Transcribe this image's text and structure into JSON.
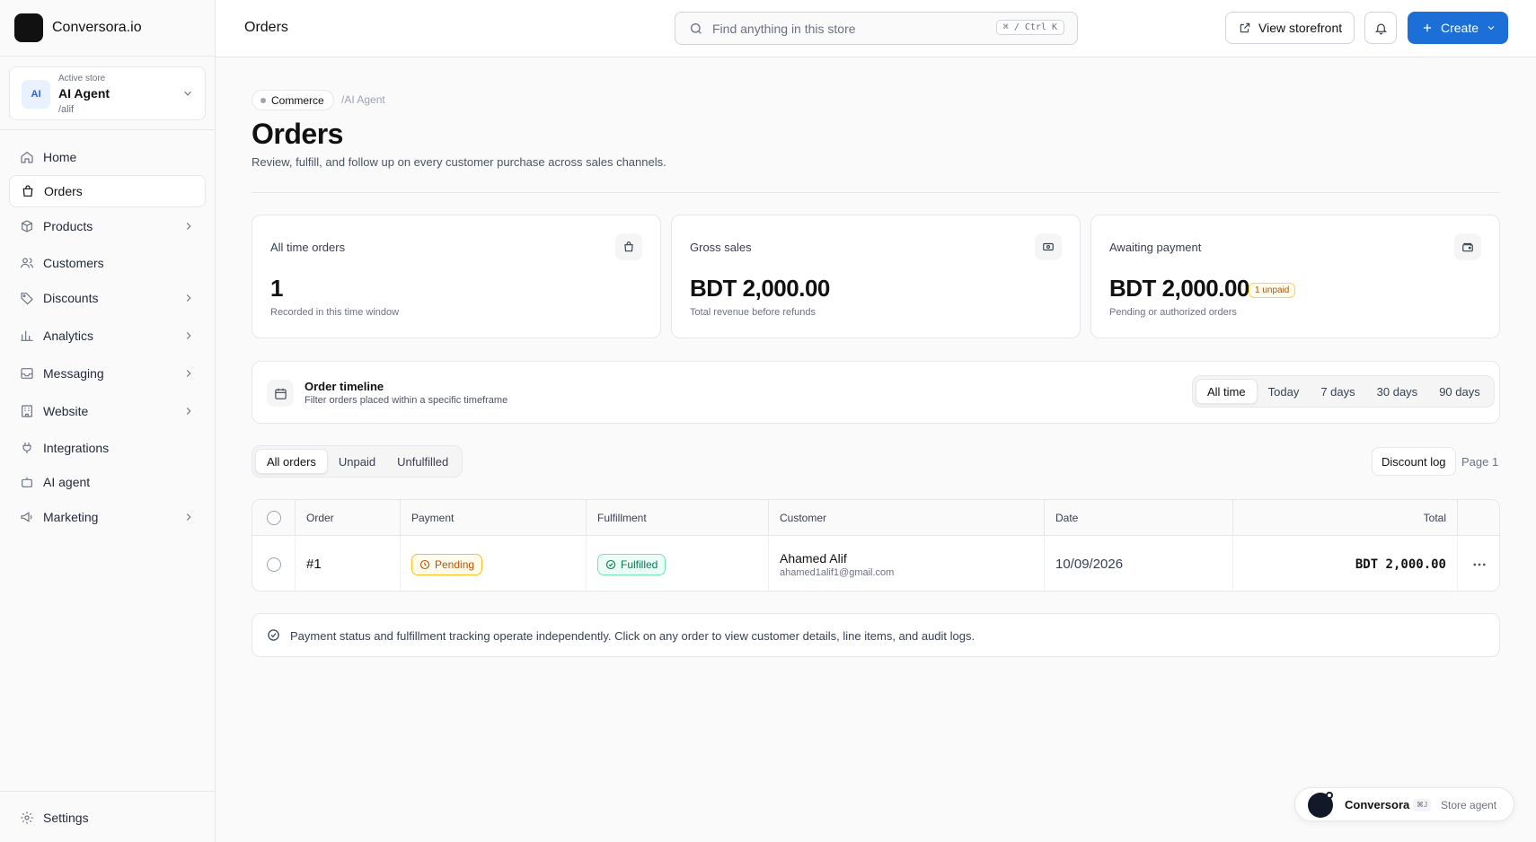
{
  "brand": {
    "name": "Conversora.io"
  },
  "store": {
    "caption": "Active store",
    "avatar": "AI",
    "name": "AI Agent",
    "handle": "/alif"
  },
  "sidebar": {
    "items": [
      {
        "label": "Home",
        "icon": "home-icon"
      },
      {
        "label": "Orders",
        "icon": "bag-icon",
        "active": true
      },
      {
        "label": "Products",
        "icon": "box-icon",
        "expandable": true
      },
      {
        "label": "Customers",
        "icon": "users-icon"
      },
      {
        "label": "Discounts",
        "icon": "tag-icon",
        "expandable": true
      },
      {
        "label": "Analytics",
        "icon": "bar-chart-icon",
        "expandable": true
      },
      {
        "label": "Messaging",
        "icon": "inbox-icon",
        "expandable": true
      },
      {
        "label": "Website",
        "icon": "building-icon",
        "expandable": true
      },
      {
        "label": "Integrations",
        "icon": "plug-icon"
      },
      {
        "label": "AI agent",
        "icon": "bot-icon"
      },
      {
        "label": "Marketing",
        "icon": "megaphone-icon",
        "expandable": true
      }
    ],
    "settings_label": "Settings"
  },
  "header": {
    "title": "Orders",
    "search_placeholder": "Find anything in this store",
    "search_shortcut": "⌘ / Ctrl K",
    "view_storefront": "View storefront",
    "create_label": "Create"
  },
  "page": {
    "breadcrumb_chip": "Commerce",
    "breadcrumb_rest": "/AI Agent",
    "title": "Orders",
    "subtitle": "Review, fulfill, and follow up on every customer purchase across sales channels."
  },
  "stats": [
    {
      "label": "All time orders",
      "value": "1",
      "note": "Recorded in this time window",
      "icon": "bag-icon"
    },
    {
      "label": "Gross sales",
      "value": "BDT 2,000.00",
      "note": "Total revenue before refunds",
      "icon": "banknote-icon"
    },
    {
      "label": "Awaiting payment",
      "value": "BDT 2,000.00",
      "badge": "1 unpaid",
      "note": "Pending or authorized orders",
      "icon": "wallet-icon"
    }
  ],
  "timeline": {
    "title": "Order timeline",
    "subtitle": "Filter orders placed within a specific timeframe",
    "ranges": [
      "All time",
      "Today",
      "7 days",
      "30 days",
      "90 days"
    ],
    "selected": "All time"
  },
  "filters": {
    "tabs": [
      "All orders",
      "Unpaid",
      "Unfulfilled"
    ],
    "selected": "All orders"
  },
  "discount_log": "Discount log",
  "page_label": "Page 1",
  "table": {
    "columns": [
      "Order",
      "Payment",
      "Fulfillment",
      "Customer",
      "Date",
      "Total"
    ],
    "rows": [
      {
        "order": "#1",
        "payment": "Pending",
        "fulfillment": "Fulfilled",
        "customer_name": "Ahamed Alif",
        "customer_email": "ahamed1alif1@gmail.com",
        "date": "10/09/2026",
        "total": "BDT 2,000.00"
      }
    ]
  },
  "notice": "Payment status and fulfillment tracking operate independently. Click on any order to view customer details, line items, and audit logs.",
  "agent": {
    "name": "Conversora",
    "shortcut": "⌘J",
    "role": "Store agent"
  },
  "colors": {
    "primary": "#1d6fd8",
    "pending": "#b45309",
    "fulfilled": "#047857"
  }
}
